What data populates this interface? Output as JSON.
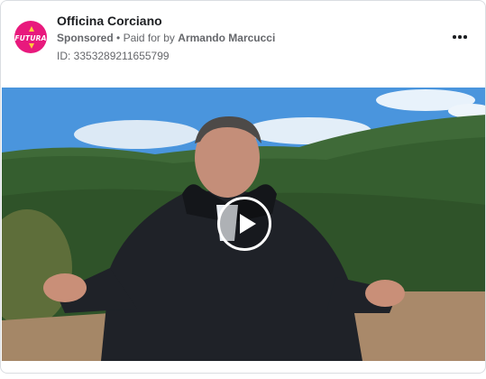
{
  "ad": {
    "page_name": "Officina Corciano",
    "logo_text": "FUTURA",
    "sponsored_label": "Sponsored",
    "paid_for_prefix": "Paid for by",
    "payer": "Armando Marcucci",
    "separator": "•",
    "id_label": "ID: 3353289211655799"
  },
  "media": {
    "type": "video",
    "play_icon": "play-icon"
  },
  "colors": {
    "brand": "#e8197d",
    "text_primary": "#1c1e21",
    "text_secondary": "#65676b",
    "border": "#dadde1"
  }
}
